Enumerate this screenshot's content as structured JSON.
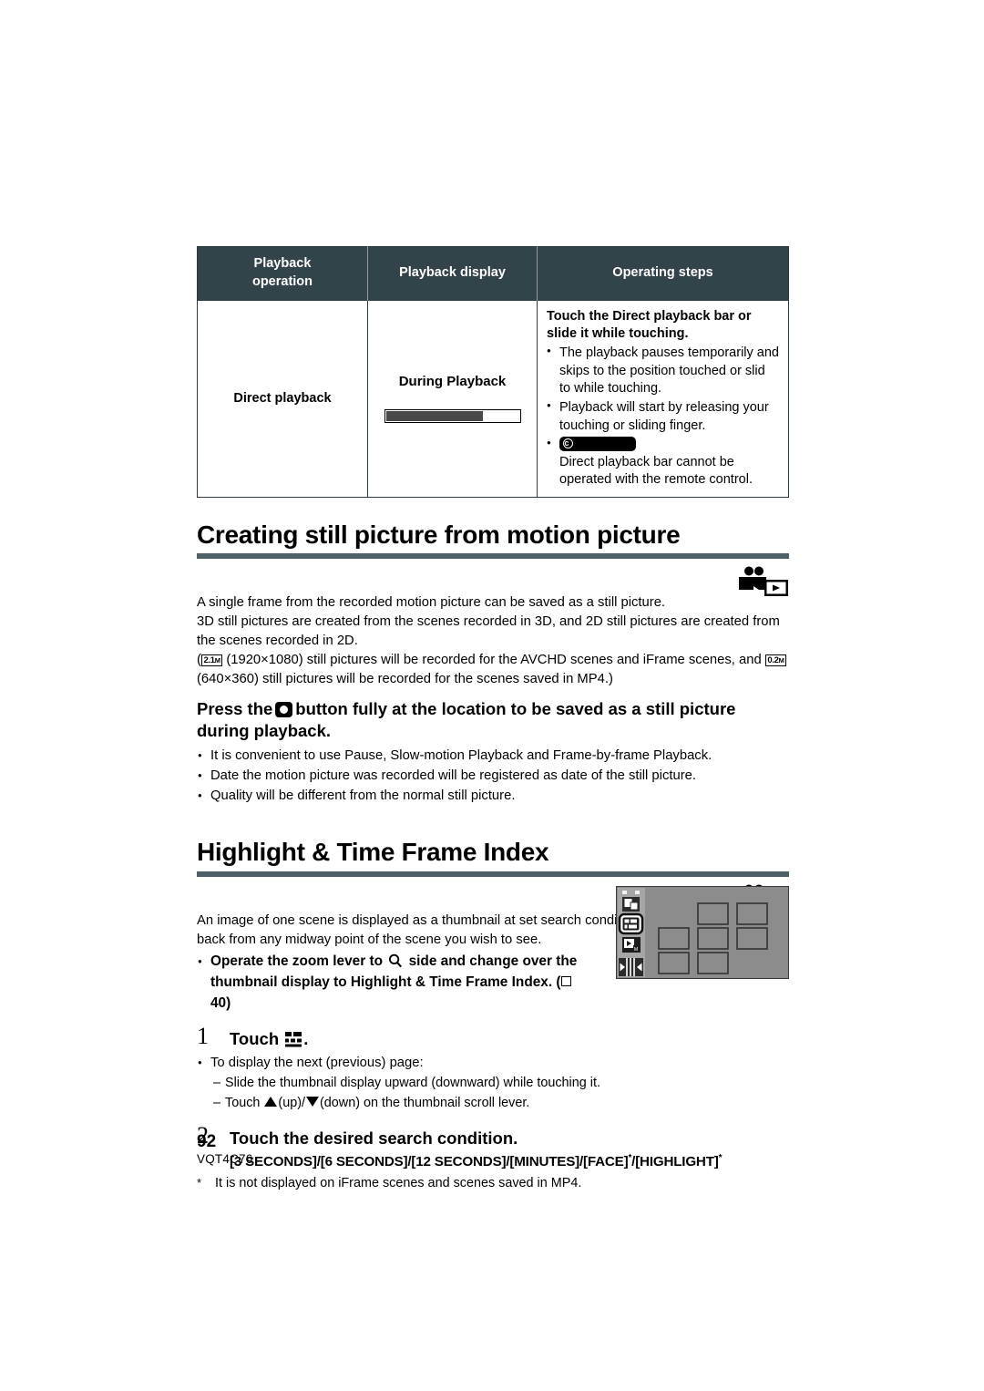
{
  "table": {
    "headers": [
      "Playback\noperation",
      "Playback display",
      "Operating steps"
    ],
    "header_op_line1": "Playback",
    "header_op_line2": "operation",
    "header_display": "Playback display",
    "header_steps": "Operating steps",
    "row": {
      "operation": "Direct playback",
      "display_label": "During Playback",
      "progress_percent": 72,
      "steps_heading": "Touch the Direct playback bar or slide it while touching.",
      "bullets": [
        "The playback pauses temporarily and skips to the position touched or slid to while touching.",
        "Playback will start by releasing your touching or sliding finger."
      ],
      "remote_note": "Direct playback bar cannot be operated with the remote control.",
      "remote_badge_glyph": "c"
    }
  },
  "section1": {
    "title": "Creating still picture from motion picture",
    "icon": "camcorder-playback-icon",
    "para1": "A single frame from the recorded motion picture can be saved as a still picture.",
    "para2": "3D still pictures are created from the scenes recorded in 3D, and 2D still pictures are created from the scenes recorded in 2D.",
    "para3_open": "(",
    "badge_21m_num": "2.1",
    "badge_21m_sub": "M",
    "para3_mid": " (1920×1080) still pictures will be recorded for the AVCHD scenes and iFrame scenes, and ",
    "badge_02m_num": "0.2",
    "badge_02m_sub": "M",
    "para3_end": " (640×360) still pictures will be recorded for the scenes saved in MP4.)",
    "instruction_pre": "Press the",
    "instruction_post": "button fully at the location to be saved as a still picture during playback.",
    "button_icon": "record-button-icon",
    "bullets": [
      "It is convenient to use Pause, Slow-motion Playback and Frame-by-frame Playback.",
      "Date the motion picture was recorded will be registered as date of the still picture.",
      "Quality will be different from the normal still picture."
    ]
  },
  "section2": {
    "title": "Highlight & Time Frame Index",
    "icon": "camcorder-playback-icon",
    "intro": "An image of one scene is displayed as a thumbnail at set search condition. Scene can be played back from any midway point of the scene you wish to see.",
    "zoom_bullet_pre": "Operate the zoom lever to",
    "zoom_bullet_post": "side and change over the thumbnail display to Highlight & Time Frame Index. (",
    "zoom_bullet_ref": " 40)",
    "zoom_icon": "magnifier-icon",
    "ref_square_icon": "page-reference-icon",
    "step1": {
      "number": "1",
      "title_pre": "Touch",
      "title_post": ".",
      "icon": "thumbnail-index-icon",
      "bullet": "To display the next (previous) page:",
      "sub1": "Slide the thumbnail display upward (downward) while touching it.",
      "sub2_pre": "Touch",
      "sub2_up": "(up)/",
      "sub2_dn": "(down) on the thumbnail scroll lever.",
      "up_icon": "triangle-up-icon",
      "down_icon": "triangle-down-icon"
    },
    "step2": {
      "number": "2",
      "title": "Touch the desired search condition.",
      "conditions": "[3 SECONDS]/[6 SECONDS]/[12 SECONDS]/[MINUTES]/[FACE]",
      "conditions_mid": "/[HIGHLIGHT]",
      "star": "*",
      "footnote_star": "*",
      "footnote": "It is not displayed on iFrame scenes and scenes saved in MP4."
    },
    "screenshot": {
      "name": "thumbnail-index-screen",
      "icons": [
        "copy-icon",
        "highlight-time-frame-index-icon",
        "playback-mode-icon",
        "scroll-lever-icon"
      ]
    }
  },
  "footer": {
    "page_number": "92",
    "doc_id": "VQT4C76"
  },
  "colors": {
    "table_header_bg": "#33434a",
    "rule_bar": "#4d6068",
    "progress_fill": "#4a4a4a",
    "screen_bg": "#8c8c8c"
  }
}
